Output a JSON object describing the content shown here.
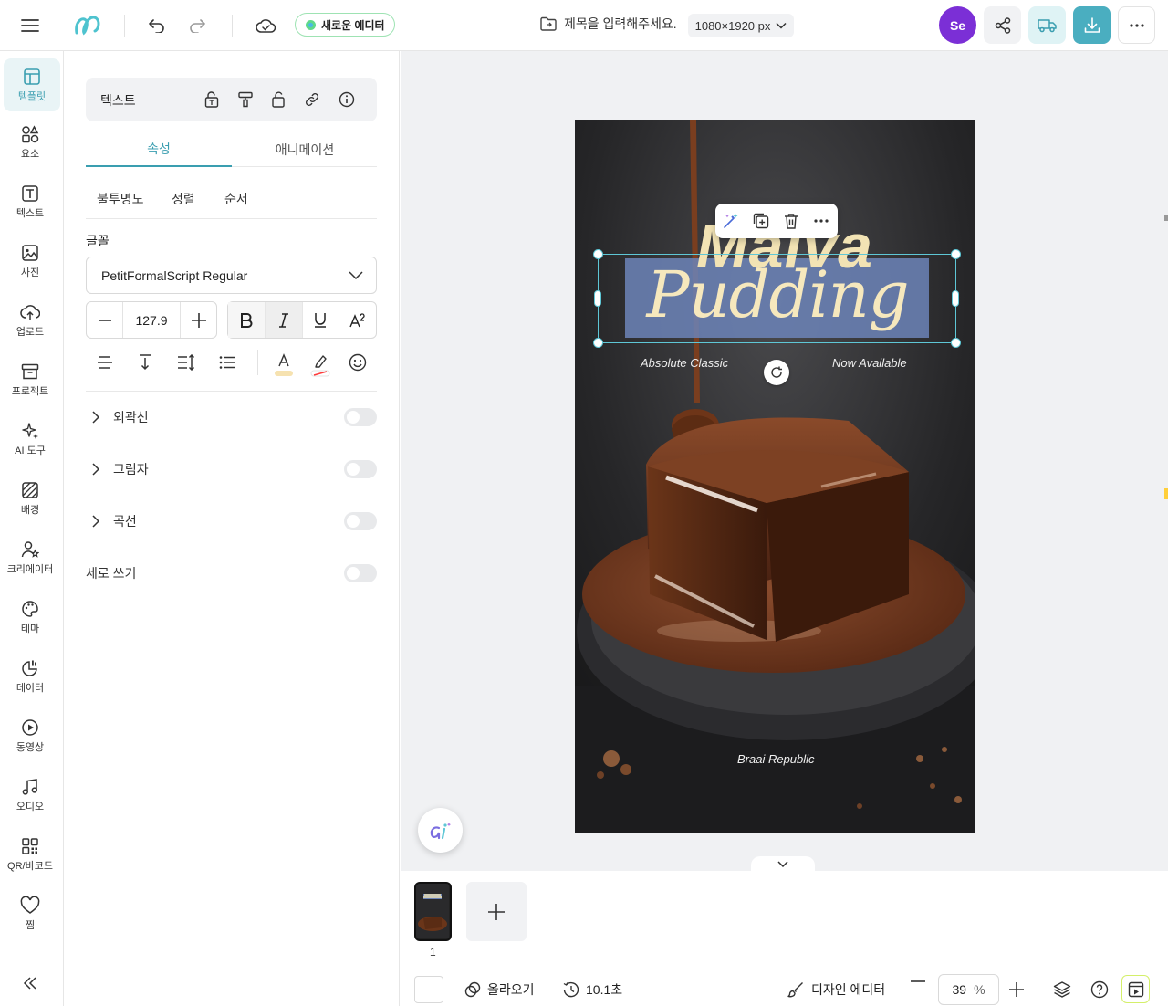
{
  "topbar": {
    "new_editor_label": "새로운 에디터",
    "title_placeholder": "제목을 입력해주세요.",
    "size_label": "1080×1920 px",
    "avatar_initials": "Se",
    "accent_color": "#4aaec0",
    "avatar_color": "#7b2fd6"
  },
  "sidebar": {
    "items": [
      {
        "label": "템플릿",
        "icon": "template-icon"
      },
      {
        "label": "요소",
        "icon": "elements-icon"
      },
      {
        "label": "텍스트",
        "icon": "text-icon"
      },
      {
        "label": "사진",
        "icon": "photo-icon"
      },
      {
        "label": "업로드",
        "icon": "upload-icon"
      },
      {
        "label": "프로젝트",
        "icon": "project-icon"
      },
      {
        "label": "AI 도구",
        "icon": "ai-tools-icon"
      },
      {
        "label": "배경",
        "icon": "background-icon"
      },
      {
        "label": "크리에이터",
        "icon": "creator-icon"
      },
      {
        "label": "테마",
        "icon": "theme-icon"
      },
      {
        "label": "데이터",
        "icon": "data-icon"
      },
      {
        "label": "동영상",
        "icon": "video-icon"
      },
      {
        "label": "오디오",
        "icon": "audio-icon"
      },
      {
        "label": "QR/바코드",
        "icon": "qr-icon"
      },
      {
        "label": "찜",
        "icon": "heart-icon"
      }
    ]
  },
  "panel": {
    "element_type": "텍스트",
    "tabs": [
      "속성",
      "애니메이션"
    ],
    "subtabs": [
      "불투명도",
      "정렬",
      "순서"
    ],
    "font_label": "글꼴",
    "font_value": "PetitFormalScript Regular",
    "font_size": "127.9",
    "text_color_swatch": "#f6e2b0",
    "highlight_swatch": "#ff3b3b",
    "toggles": [
      {
        "label": "외곽선",
        "expandable": true,
        "on": false
      },
      {
        "label": "그림자",
        "expandable": true,
        "on": false
      },
      {
        "label": "곡선",
        "expandable": true,
        "on": false
      },
      {
        "label": "세로 쓰기",
        "expandable": false,
        "on": false
      }
    ]
  },
  "artboard": {
    "title_line1": "Malva",
    "title_line2": "Pudding",
    "subtitle_left": "Absolute Classic",
    "subtitle_right": "Now Available",
    "brand": "Braai Republic"
  },
  "pages": {
    "page_number": "1"
  },
  "bottombar": {
    "upload_label": "올라오기",
    "duration": "10.1초",
    "design_editor_label": "디자인 에디터",
    "zoom_value": "39",
    "zoom_unit": "%"
  }
}
